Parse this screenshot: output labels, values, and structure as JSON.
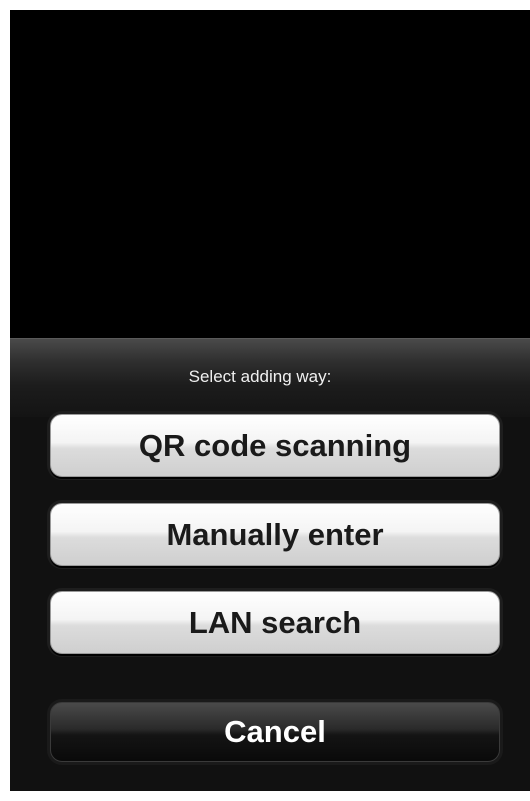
{
  "dialog": {
    "title": "Select adding way:",
    "options": [
      {
        "label": "QR code scanning"
      },
      {
        "label": "Manually enter"
      },
      {
        "label": "LAN search"
      }
    ],
    "cancel_label": "Cancel"
  },
  "colors": {
    "background": "#000000",
    "button_light": "#e8e8e8",
    "button_dark": "#1a1a1a",
    "text_dark": "#1a1a1a",
    "text_light": "#ffffff"
  }
}
